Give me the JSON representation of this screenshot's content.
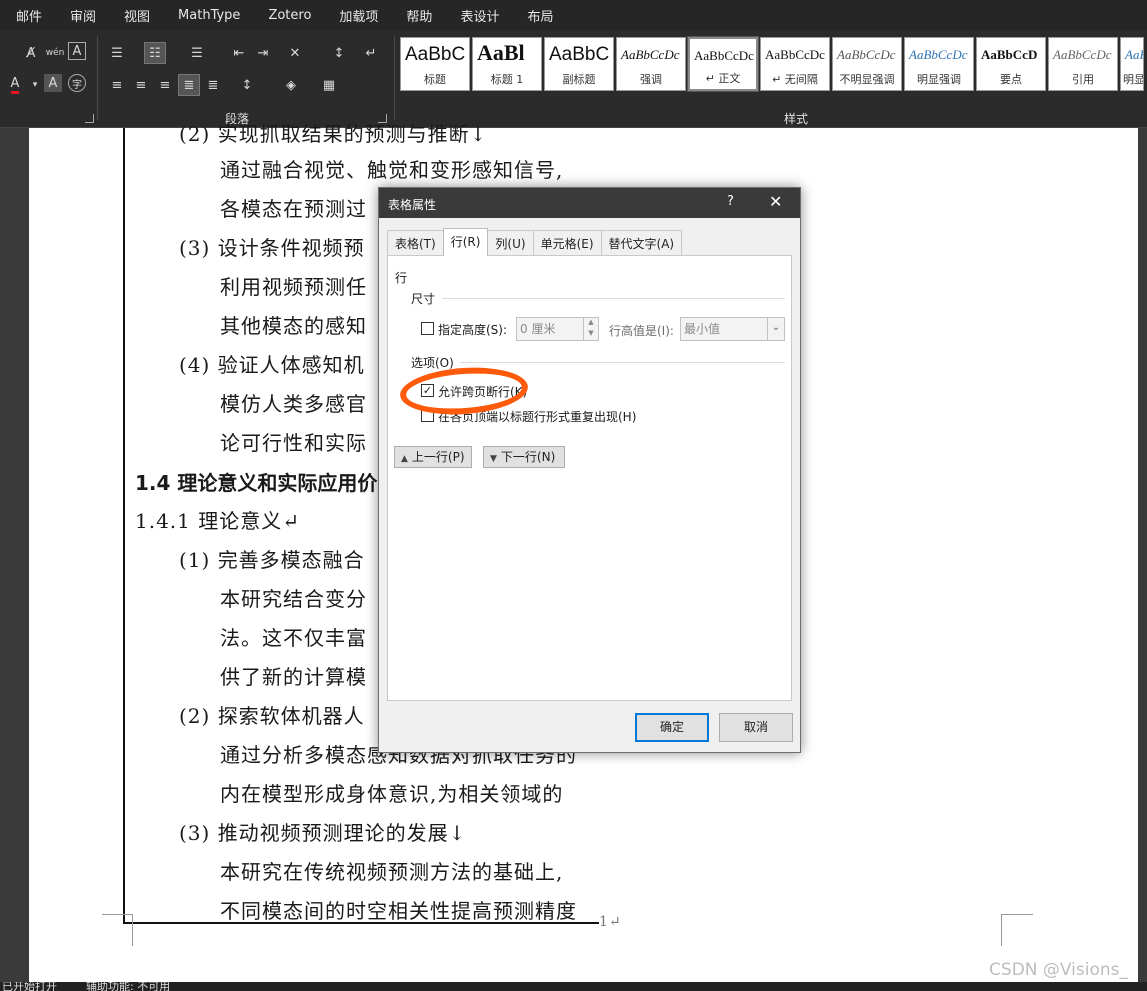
{
  "menubar": [
    "邮件",
    "审阅",
    "视图",
    "MathType",
    "Zotero",
    "加载项",
    "帮助",
    "表设计",
    "布局"
  ],
  "ribbon": {
    "paragraph_group_label": "段落",
    "styles_group_label": "样式",
    "styles": [
      {
        "sample": "AaBbC",
        "name": "标题"
      },
      {
        "sample": "AaBl",
        "name": "标题 1"
      },
      {
        "sample": "AaBbC",
        "name": "副标题"
      },
      {
        "sample": "AaBbCcDc",
        "name": "强调"
      },
      {
        "sample": "AaBbCcDc",
        "name": "↵ 正文"
      },
      {
        "sample": "AaBbCcDc",
        "name": "↵ 无间隔"
      },
      {
        "sample": "AaBbCcDc",
        "name": "不明显强调"
      },
      {
        "sample": "AaBbCcDc",
        "name": "明显强调"
      },
      {
        "sample": "AaBbCcD",
        "name": "要点"
      },
      {
        "sample": "AaBbCcDc",
        "name": "引用"
      },
      {
        "sample": "AaB",
        "name": "明显"
      }
    ],
    "font_color": "#e81123"
  },
  "document": {
    "lines": [
      "(2) 实现抓取结果的预测与推断↓",
      "通过融合视觉、触觉和变形感知信号,",
      "各模态在预测过",
      "(3) 设计条件视频预",
      "利用视频预测任",
      "其他模态的感知",
      "(4) 验证人体感知机",
      "模仿人类多感官",
      "论可行性和实际",
      "1.4 理论意义和实际应用价",
      "1.4.1 理论意义↵",
      "(1) 完善多模态融合",
      "本研究结合变分",
      "法。这不仅丰富",
      "供了新的计算模",
      "(2) 探索软体机器人",
      "通过分析多模态感知数据对抓取任务的",
      "内在模型形成身体意识,为相关领域的",
      "(3) 推动视频预测理论的发展↓",
      "本研究在传统视频预测方法的基础上,",
      "不同模态间的时空相关性提高预测精度"
    ],
    "page_marker": "1↵",
    "watermark": "CSDN @Visions_"
  },
  "dialog": {
    "title": "表格属性",
    "help": "?",
    "close": "✕",
    "tabs": [
      "表格(T)",
      "行(R)",
      "列(U)",
      "单元格(E)",
      "替代文字(A)"
    ],
    "active_tab": 1,
    "section_row": "行",
    "size_label": "尺寸",
    "specify_height": {
      "label": "指定高度(S):",
      "checked": false,
      "value": "0 厘米"
    },
    "row_height_is_label": "行高值是(I):",
    "row_height_mode": "最小值",
    "options_label": "选项(O)",
    "allow_break": {
      "label": "允许跨页断行(K)",
      "checked": true
    },
    "repeat_header": {
      "label": "在各页顶端以标题行形式重复出现(H)",
      "checked": false
    },
    "prev_row": "上一行(P)",
    "next_row": "下一行(N)",
    "ok": "确定",
    "cancel": "取消"
  },
  "annotation": {
    "color": "#ff5a0a",
    "meaning": "circled checkbox"
  },
  "statusbar": {
    "left": "已开始打开",
    "middle": "辅助功能: 不可用"
  }
}
